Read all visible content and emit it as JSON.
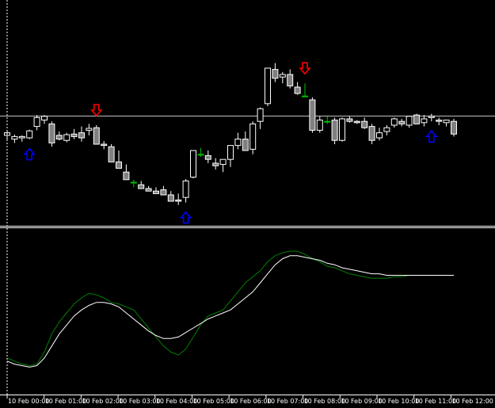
{
  "colors": {
    "background": "#000000",
    "axis": "#ffffff",
    "grid_line": "#c0c0c0",
    "bull_candle": "#000000",
    "bear_candle": "#808080",
    "doji_candle": "#00c000",
    "up_arrow": "#0000ff",
    "down_arrow": "#ff0000",
    "oscillator_main": "#ffffff",
    "oscillator_signal": "#008000"
  },
  "chart_data": [
    {
      "type": "candlestick",
      "panel": "price",
      "grid": false,
      "y_range": [
        0,
        100
      ],
      "horizontal_level": 75,
      "candles": [
        {
          "i": 0,
          "o": 44,
          "h": 50,
          "l": 36,
          "c": 48
        },
        {
          "i": 1,
          "o": 38,
          "h": 45,
          "l": 32,
          "c": 42
        },
        {
          "i": 2,
          "o": 40,
          "h": 44,
          "l": 34,
          "c": 42
        },
        {
          "i": 3,
          "o": 40,
          "h": 53,
          "l": 38,
          "c": 51
        },
        {
          "i": 4,
          "o": 58,
          "h": 76,
          "l": 52,
          "c": 72
        },
        {
          "i": 5,
          "o": 68,
          "h": 76,
          "l": 62,
          "c": 74
        },
        {
          "i": 6,
          "o": 62,
          "h": 66,
          "l": 26,
          "c": 32
        },
        {
          "i": 7,
          "o": 44,
          "h": 50,
          "l": 36,
          "c": 38
        },
        {
          "i": 8,
          "o": 36,
          "h": 48,
          "l": 33,
          "c": 45
        },
        {
          "i": 9,
          "o": 46,
          "h": 54,
          "l": 38,
          "c": 42
        },
        {
          "i": 10,
          "o": 48,
          "h": 58,
          "l": 34,
          "c": 40
        },
        {
          "i": 11,
          "o": 52,
          "h": 62,
          "l": 44,
          "c": 55
        },
        {
          "i": 12,
          "o": 56,
          "h": 60,
          "l": 32,
          "c": 30
        },
        {
          "i": 13,
          "o": 30,
          "h": 35,
          "l": 22,
          "c": 28
        },
        {
          "i": 14,
          "o": 26,
          "h": 30,
          "l": 2,
          "c": 2
        },
        {
          "i": 15,
          "o": 2,
          "h": 20,
          "l": -6,
          "c": -8
        },
        {
          "i": 16,
          "o": -14,
          "h": -2,
          "l": -20,
          "c": -26
        },
        {
          "i": 17,
          "o": -30,
          "h": -26,
          "l": -38,
          "c": -30
        },
        {
          "i": 18,
          "o": -34,
          "h": -28,
          "l": -40,
          "c": -40
        },
        {
          "i": 19,
          "o": -40,
          "h": -36,
          "l": -44,
          "c": -44
        },
        {
          "i": 20,
          "o": -44,
          "h": -38,
          "l": -48,
          "c": -48
        },
        {
          "i": 21,
          "o": -42,
          "h": -36,
          "l": -50,
          "c": -50
        },
        {
          "i": 22,
          "o": -50,
          "h": -44,
          "l": -60,
          "c": -60
        },
        {
          "i": 23,
          "o": -58,
          "h": -48,
          "l": -66,
          "c": -60
        },
        {
          "i": 24,
          "o": -54,
          "h": -25,
          "l": -62,
          "c": -28
        },
        {
          "i": 25,
          "o": -22,
          "h": 20,
          "l": -24,
          "c": 20
        },
        {
          "i": 26,
          "o": 14,
          "h": 24,
          "l": 10,
          "c": 14
        },
        {
          "i": 27,
          "o": 12,
          "h": 20,
          "l": 0,
          "c": 6
        },
        {
          "i": 28,
          "o": 0,
          "h": 8,
          "l": -10,
          "c": -4
        },
        {
          "i": 29,
          "o": -2,
          "h": 6,
          "l": -14,
          "c": 6
        },
        {
          "i": 30,
          "o": 6,
          "h": 28,
          "l": -6,
          "c": 28
        },
        {
          "i": 31,
          "o": 28,
          "h": 48,
          "l": 22,
          "c": 38
        },
        {
          "i": 32,
          "o": 38,
          "h": 50,
          "l": 28,
          "c": 20
        },
        {
          "i": 33,
          "o": 22,
          "h": 66,
          "l": 14,
          "c": 62
        },
        {
          "i": 34,
          "o": 66,
          "h": 88,
          "l": 54,
          "c": 86
        },
        {
          "i": 35,
          "o": 94,
          "h": 150,
          "l": 90,
          "c": 150
        },
        {
          "i": 36,
          "o": 148,
          "h": 158,
          "l": 128,
          "c": 134
        },
        {
          "i": 37,
          "o": 136,
          "h": 144,
          "l": 126,
          "c": 140
        },
        {
          "i": 38,
          "o": 140,
          "h": 148,
          "l": 118,
          "c": 122
        },
        {
          "i": 39,
          "o": 120,
          "h": 128,
          "l": 108,
          "c": 110
        },
        {
          "i": 40,
          "o": 106,
          "h": 126,
          "l": 104,
          "c": 106
        },
        {
          "i": 41,
          "o": 100,
          "h": 104,
          "l": 48,
          "c": 52
        },
        {
          "i": 42,
          "o": 52,
          "h": 74,
          "l": 48,
          "c": 68
        },
        {
          "i": 43,
          "o": 66,
          "h": 74,
          "l": 62,
          "c": 66
        },
        {
          "i": 44,
          "o": 68,
          "h": 72,
          "l": 30,
          "c": 36
        },
        {
          "i": 45,
          "o": 36,
          "h": 72,
          "l": 34,
          "c": 70
        },
        {
          "i": 46,
          "o": 70,
          "h": 74,
          "l": 64,
          "c": 66
        },
        {
          "i": 47,
          "o": 66,
          "h": 68,
          "l": 62,
          "c": 64
        },
        {
          "i": 48,
          "o": 66,
          "h": 72,
          "l": 54,
          "c": 56
        },
        {
          "i": 49,
          "o": 58,
          "h": 62,
          "l": 30,
          "c": 36
        },
        {
          "i": 50,
          "o": 40,
          "h": 56,
          "l": 36,
          "c": 48
        },
        {
          "i": 51,
          "o": 50,
          "h": 60,
          "l": 44,
          "c": 56
        },
        {
          "i": 52,
          "o": 60,
          "h": 72,
          "l": 56,
          "c": 70
        },
        {
          "i": 53,
          "o": 66,
          "h": 70,
          "l": 58,
          "c": 62
        },
        {
          "i": 54,
          "o": 60,
          "h": 74,
          "l": 56,
          "c": 74
        },
        {
          "i": 55,
          "o": 76,
          "h": 78,
          "l": 62,
          "c": 62
        },
        {
          "i": 56,
          "o": 64,
          "h": 76,
          "l": 58,
          "c": 70
        },
        {
          "i": 57,
          "o": 72,
          "h": 78,
          "l": 66,
          "c": 74
        },
        {
          "i": 58,
          "o": 68,
          "h": 72,
          "l": 60,
          "c": 66
        },
        {
          "i": 59,
          "o": 64,
          "h": 68,
          "l": 58,
          "c": 68
        },
        {
          "i": 60,
          "o": 66,
          "h": 70,
          "l": 42,
          "c": 46
        }
      ],
      "signals": [
        {
          "type": "up",
          "i": 3
        },
        {
          "type": "down",
          "i": 12
        },
        {
          "type": "up",
          "i": 24
        },
        {
          "type": "down",
          "i": 40
        },
        {
          "type": "up",
          "i": 57
        }
      ]
    },
    {
      "type": "line",
      "panel": "oscillator",
      "y_range": [
        0,
        100
      ],
      "grid": false,
      "series": [
        {
          "color": "#008000",
          "values": [
            20,
            18,
            16,
            15,
            16,
            24,
            36,
            44,
            50,
            56,
            60,
            63,
            62,
            60,
            57,
            56,
            54,
            52,
            46,
            40,
            34,
            28,
            24,
            22,
            26,
            34,
            42,
            48,
            50,
            52,
            58,
            64,
            70,
            74,
            78,
            84,
            88,
            90,
            91,
            91,
            89,
            86,
            84,
            81,
            80,
            78,
            76,
            75,
            74,
            73,
            73,
            73,
            74,
            74,
            75,
            75,
            75,
            75,
            75,
            75,
            75
          ]
        },
        {
          "color": "#ffffff",
          "values": [
            18,
            16,
            15,
            14,
            15,
            20,
            28,
            36,
            42,
            48,
            52,
            55,
            57,
            57,
            56,
            54,
            50,
            46,
            42,
            38,
            35,
            33,
            33,
            34,
            37,
            40,
            43,
            46,
            48,
            50,
            52,
            56,
            60,
            64,
            70,
            76,
            82,
            86,
            88,
            88,
            87,
            86,
            85,
            83,
            82,
            80,
            79,
            78,
            77,
            76,
            76,
            75,
            75,
            75,
            75,
            75,
            75,
            75,
            75,
            75,
            75
          ]
        }
      ]
    }
  ],
  "x_axis": {
    "tick_labels": [
      "10 Feb 00:00",
      "10 Feb 01:00",
      "10 Feb 02:00",
      "10 Feb 03:00",
      "10 Feb 04:00",
      "10 Feb 05:00",
      "10 Feb 06:00",
      "10 Feb 07:00",
      "10 Feb 08:00",
      "10 Feb 09:00",
      "10 Feb 10:00",
      "10 Feb 11:00",
      "10 Feb 12:00"
    ]
  }
}
